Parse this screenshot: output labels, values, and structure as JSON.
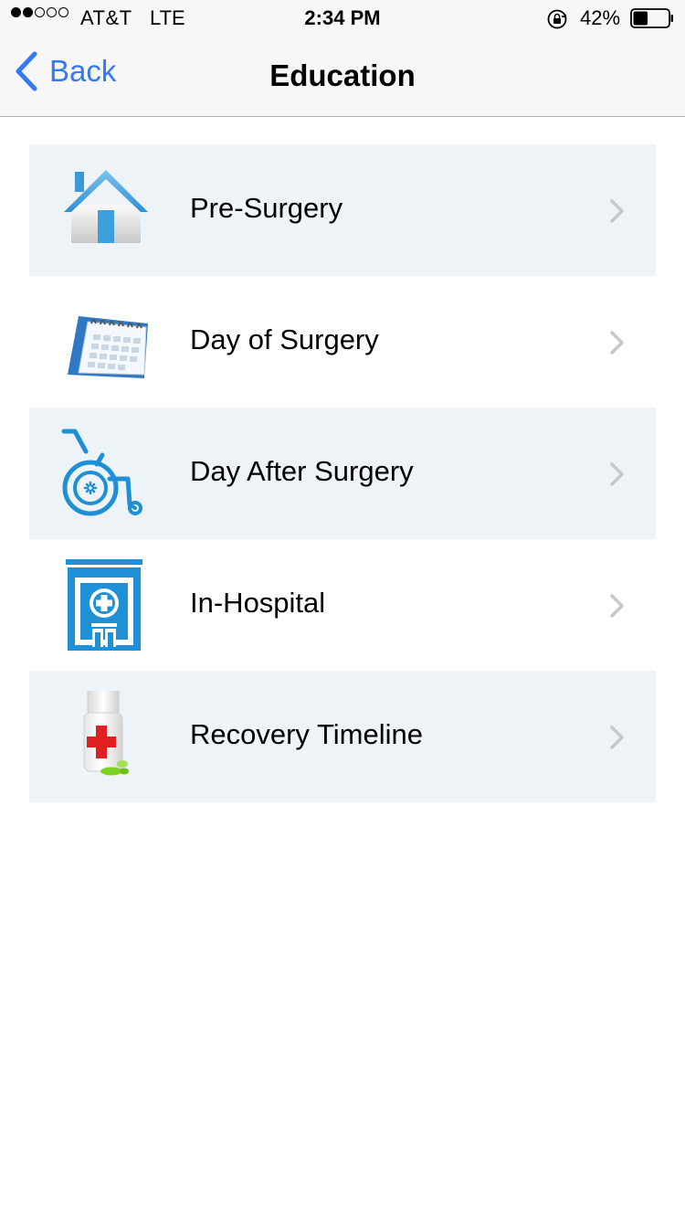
{
  "status_bar": {
    "signal_filled": 2,
    "signal_total": 5,
    "carrier": "AT&T",
    "network": "LTE",
    "time": "2:34 PM",
    "battery_percent": "42%",
    "battery_level": 0.42,
    "icons": [
      "signal-dots-icon",
      "orientation-lock-icon",
      "battery-icon"
    ]
  },
  "nav": {
    "back_label": "Back",
    "title": "Education",
    "accent_color": "#3478f6",
    "icons": [
      "chevron-left-icon"
    ]
  },
  "menu": {
    "items": [
      {
        "label": "Pre-Surgery",
        "icon": "house-icon"
      },
      {
        "label": "Day of Surgery",
        "icon": "calendar-icon"
      },
      {
        "label": "Day After Surgery",
        "icon": "wheelchair-icon"
      },
      {
        "label": "In-Hospital",
        "icon": "hospital-icon"
      },
      {
        "label": "Recovery Timeline",
        "icon": "medicine-bottle-icon"
      }
    ],
    "shaded_row_color": "#edf3f7",
    "icon_blue": "#1f8fd6"
  }
}
